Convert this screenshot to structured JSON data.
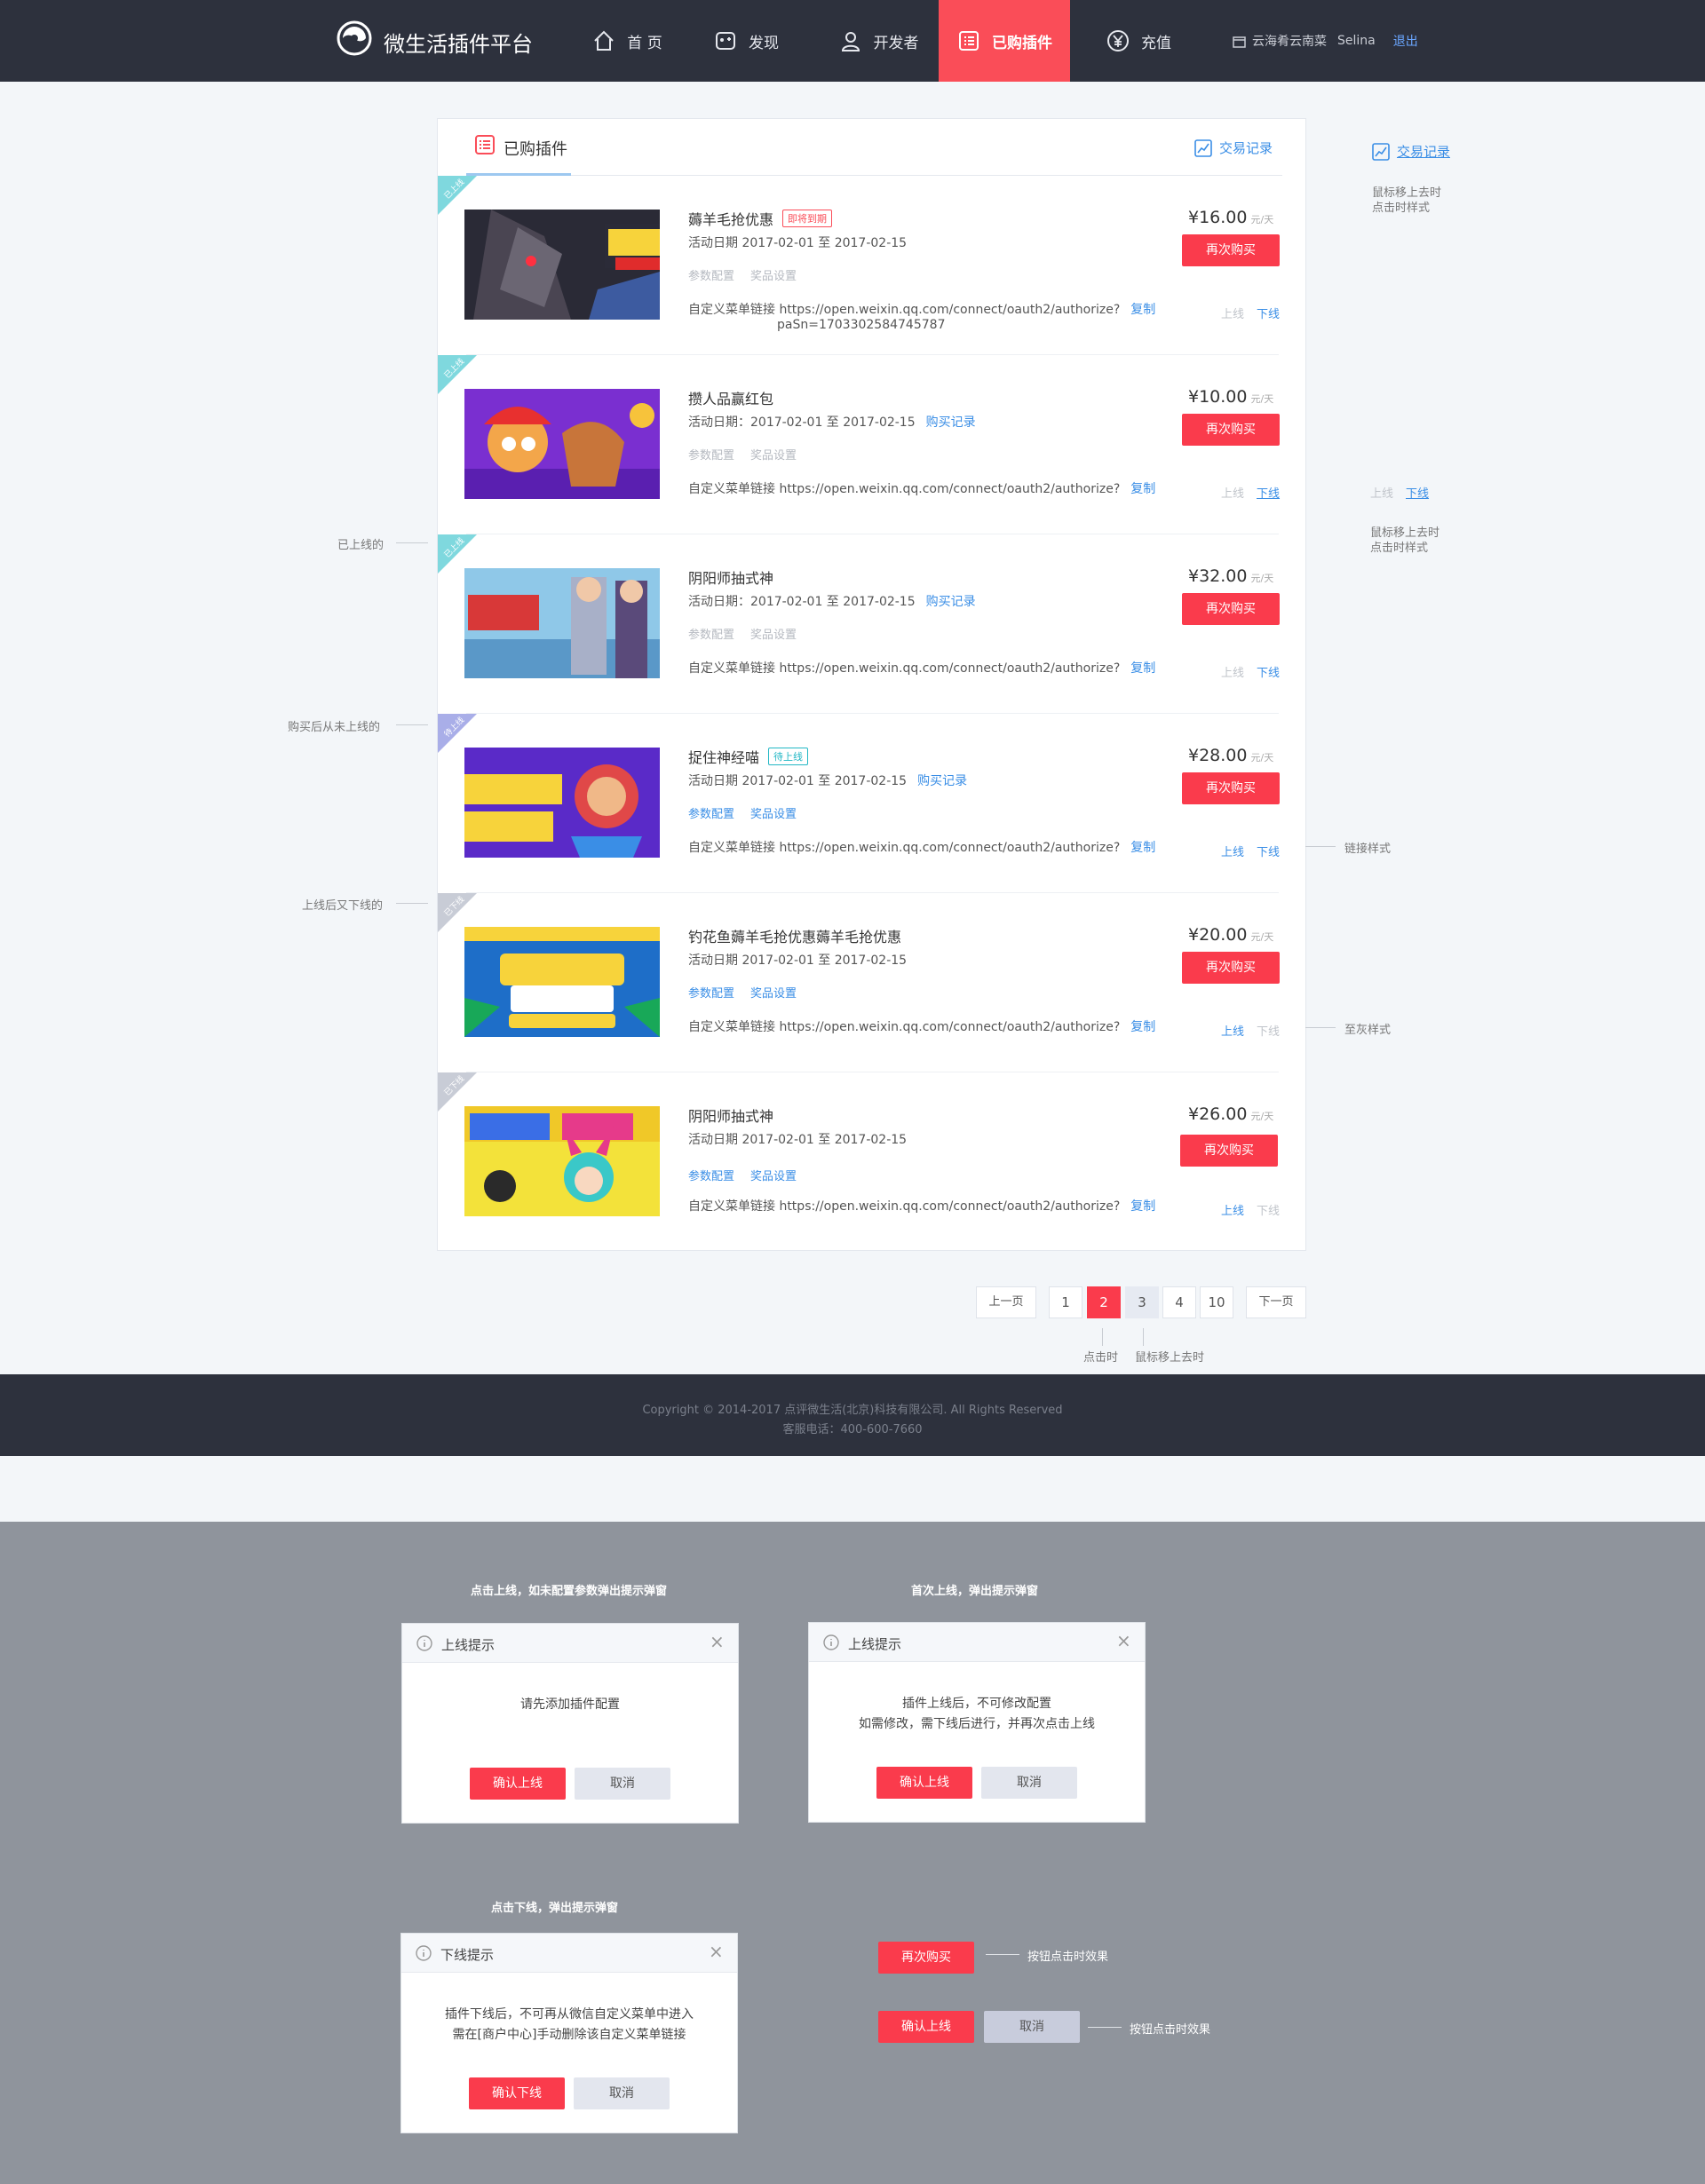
{
  "nav": {
    "logo_text": "微生活插件平台",
    "items": [
      {
        "label": "首 页",
        "icon": "home-icon"
      },
      {
        "label": "发现",
        "icon": "discover-icon"
      },
      {
        "label": "开发者",
        "icon": "developer-icon"
      },
      {
        "label": "已购插件",
        "icon": "list-icon",
        "active": true
      },
      {
        "label": "充值",
        "icon": "yen-icon"
      }
    ],
    "shop": "云海肴云南菜",
    "user": "Selina",
    "logout": "退出"
  },
  "panel": {
    "title": "已购插件",
    "records": "交易记录"
  },
  "plugins": [
    {
      "status": "已上线",
      "name": "薅羊毛抢优惠",
      "tag": "即将到期",
      "date": "活动日期 2017-02-01 至 2017-02-15",
      "purchase_record": "",
      "cfg": "参数配置",
      "prize": "奖品设置",
      "link": "自定义菜单链接 https://open.weixin.qq.com/connect/oauth2/authorize?",
      "link2": "paSn=1703302584745787",
      "copy": "复制",
      "price": "¥16.00",
      "unit": "元/天",
      "buy": "再次购买",
      "on": "上线",
      "off": "下线"
    },
    {
      "status": "已上线",
      "name": "攒人品赢红包",
      "tag": "",
      "date": "活动日期：2017-02-01 至 2017-02-15",
      "purchase_record": "购买记录",
      "cfg": "参数配置",
      "prize": "奖品设置",
      "link": "自定义菜单链接 https://open.weixin.qq.com/connect/oauth2/authorize?",
      "link2": "",
      "copy": "复制",
      "price": "¥10.00",
      "unit": "元/天",
      "buy": "再次购买",
      "on": "上线",
      "off": "下线"
    },
    {
      "status": "已上线",
      "name": "阴阳师抽式神",
      "tag": "",
      "date": "活动日期：2017-02-01 至 2017-02-15",
      "purchase_record": "购买记录",
      "cfg": "参数配置",
      "prize": "奖品设置",
      "link": "自定义菜单链接 https://open.weixin.qq.com/connect/oauth2/authorize?",
      "link2": "",
      "copy": "复制",
      "price": "¥32.00",
      "unit": "元/天",
      "buy": "再次购买",
      "on": "上线",
      "off": "下线"
    },
    {
      "status": "待上线",
      "name": "捉住神经喵",
      "tag": "待上线",
      "date": "活动日期 2017-02-01 至 2017-02-15",
      "purchase_record": "购买记录",
      "cfg": "参数配置",
      "prize": "奖品设置",
      "link": "自定义菜单链接 https://open.weixin.qq.com/connect/oauth2/authorize?",
      "link2": "",
      "copy": "复制",
      "price": "¥28.00",
      "unit": "元/天",
      "buy": "再次购买",
      "on": "上线",
      "off": "下线"
    },
    {
      "status": "已下线",
      "name": "钓花鱼薅羊毛抢优惠薅羊毛抢优惠",
      "tag": "",
      "date": "活动日期 2017-02-01 至 2017-02-15",
      "purchase_record": "",
      "cfg": "参数配置",
      "prize": "奖品设置",
      "link": "自定义菜单链接 https://open.weixin.qq.com/connect/oauth2/authorize?",
      "link2": "",
      "copy": "复制",
      "price": "¥20.00",
      "unit": "元/天",
      "buy": "再次购买",
      "on": "上线",
      "off": "下线"
    },
    {
      "status": "已下线",
      "name": "阴阳师抽式神",
      "tag": "",
      "date": "活动日期 2017-02-01 至 2017-02-15",
      "purchase_record": "",
      "cfg": "参数配置",
      "prize": "奖品设置",
      "link": "自定义菜单链接 https://open.weixin.qq.com/connect/oauth2/authorize?",
      "link2": "",
      "copy": "复制",
      "price": "¥26.00",
      "unit": "元/天",
      "buy": "再次购买",
      "on": "上线",
      "off": "下线"
    }
  ],
  "side_notes": {
    "records": "交易记录",
    "hover_note_1": "鼠标移上去时",
    "hover_note_2": "点击时样式",
    "on": "上线",
    "off": "下线",
    "hover_note_3": "鼠标移上去时",
    "hover_note_4": "点击时样式",
    "link_style": "链接样式",
    "gray_style": "至灰样式"
  },
  "left_notes": {
    "online": "已上线的",
    "never_online": "购买后从未上线的",
    "online_then_off": "上线后又下线的"
  },
  "pagination": {
    "prev": "上一页",
    "pages": [
      "1",
      "2",
      "3",
      "4",
      "10"
    ],
    "next": "下一页",
    "note_click": "点击时",
    "note_hover": "鼠标移上去时"
  },
  "footer": {
    "copyright": "Copyright © 2014-2017 点评微生活(北京)科技有限公司. All Rights Reserved",
    "phone": "客服电话：400-600-7660"
  },
  "modals": {
    "m1_caption": "点击上线，如未配置参数弹出提示弹窗",
    "m1_title": "上线提示",
    "m1_body": "请先添加插件配置",
    "m1_ok": "确认上线",
    "m1_cancel": "取消",
    "m2_caption": "首次上线，弹出提示弹窗",
    "m2_title": "上线提示",
    "m2_body_1": "插件上线后，不可修改配置",
    "m2_body_2": "如需修改，需下线后进行，并再次点击上线",
    "m2_ok": "确认上线",
    "m2_cancel": "取消",
    "m3_caption": "点击下线，弹出提示弹窗",
    "m3_title": "下线提示",
    "m3_body_1": "插件下线后，不可再从微信自定义菜单中进入",
    "m3_body_2": "需在[商户中心]手动删除该自定义菜单链接",
    "m3_ok": "确认下线",
    "m3_cancel": "取消",
    "demo_buy": "再次购买",
    "demo_note_1": "按钮点击时效果",
    "demo_ok": "确认上线",
    "demo_cancel": "取消",
    "demo_note_2": "按钮点击时效果"
  },
  "colors": {
    "nav_bg": "#2d313d",
    "accent": "#fa3b4c",
    "link": "#3a8ee6",
    "ribbon_online": "#7fd8de",
    "ribbon_pending": "#a9aee8",
    "ribbon_offline": "#c8ccd6"
  }
}
